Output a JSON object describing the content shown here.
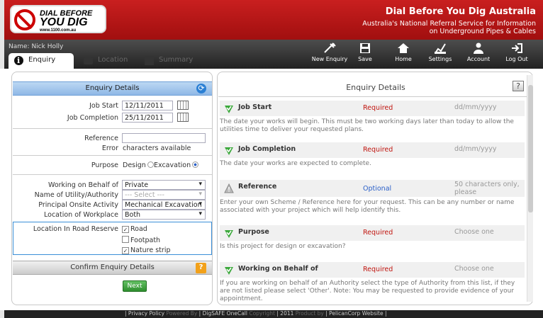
{
  "brand": {
    "logo_line1": "DIAL BEFORE",
    "logo_line2": "YOU DIG",
    "logo_url": "www.1100.com.au",
    "title": "Dial Before You Dig Australia",
    "subtitle_line1": "Australia's National Referral Service for Information",
    "subtitle_line2": "on Underground Pipes & Cables"
  },
  "nav": {
    "user": "Name: Nick Holly",
    "tabs": [
      {
        "label": "Enquiry",
        "icon": "info-icon"
      },
      {
        "label": "Location",
        "icon": "lock-icon"
      },
      {
        "label": "Summary",
        "icon": "check-icon"
      }
    ],
    "buttons": [
      {
        "label": "New Enquiry",
        "icon": "new-enquiry-icon"
      },
      {
        "label": "Save",
        "icon": "save-icon"
      },
      {
        "label": "Home",
        "icon": "home-icon"
      },
      {
        "label": "Settings",
        "icon": "settings-icon"
      },
      {
        "label": "Account",
        "icon": "account-icon"
      },
      {
        "label": "Log Out",
        "icon": "logout-icon"
      }
    ]
  },
  "form": {
    "title": "Enquiry Details",
    "job_start_label": "Job Start",
    "job_start": "12/11/2011",
    "job_completion_label": "Job Completion",
    "job_completion": "25/11/2011",
    "reference_label": "Reference",
    "reference": "",
    "error_label": "Error",
    "error_text": "characters available",
    "purpose_label": "Purpose",
    "purpose_design": "Design",
    "purpose_excavation": "Excavation",
    "purpose_selected": "Excavation",
    "behalf_label": "Working on Behalf of",
    "behalf": "Private",
    "utility_label": "Name of Utility/Authority",
    "utility": "--- Select ---",
    "activity_label": "Principal Onsite Activity",
    "activity": "Mechanical Excavation",
    "workplace_label": "Location of Workplace",
    "workplace": "Both",
    "road_label": "Location In Road Reserve",
    "road": "Road",
    "footpath": "Footpath",
    "nature": "Nature strip",
    "road_checked": true,
    "footpath_checked": false,
    "nature_checked": true,
    "confirm_title": "Confirm Enquiry Details",
    "next": "Next"
  },
  "details": {
    "title": "Enquiry Details",
    "items": [
      {
        "name": "Job Start",
        "status": "Required",
        "hint": "dd/mm/yyyy",
        "desc": "The date your works will begin. This must be two working days later than today to allow the utilities time to deliver your requested plans."
      },
      {
        "name": "Job Completion",
        "status": "Required",
        "hint": "dd/mm/yyyy",
        "desc": "The date your works are expected to complete."
      },
      {
        "name": "Reference",
        "status": "Optional",
        "hint": "50 characters only, please",
        "desc": "Enter your own Scheme / Reference here for your request. This can be any number or name associated with your project which will help identify this."
      },
      {
        "name": "Purpose",
        "status": "Required",
        "hint": "Choose one",
        "desc": "Is this project for design or excavation?"
      },
      {
        "name": "Working on Behalf of",
        "status": "Required",
        "hint": "Choose one",
        "desc": "If you are working on behalf of an Authority select the type of Authority from this list, if they are not listed please select 'Other'. Note: You may be requested to provide evidence of your appointment."
      }
    ]
  },
  "footer": {
    "privacy": "Privacy Policy",
    "powered": "Powered By",
    "digsafe": "DigSAFE OneCall",
    "copyright": "Copyright",
    "year": "2011",
    "product": "Product by",
    "pelican": "PelicanCorp",
    "website": "Website"
  },
  "colors": {
    "brand_red": "#b81717",
    "required": "#c0150f",
    "optional": "#2a5fc8",
    "accent_blue": "#3a8fd8"
  }
}
